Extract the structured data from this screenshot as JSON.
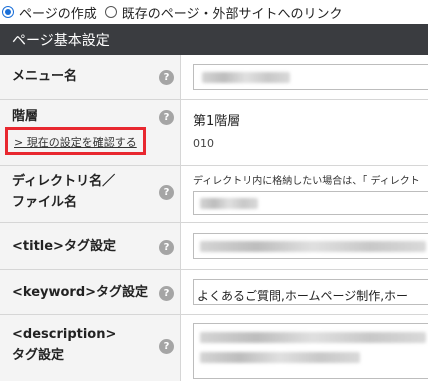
{
  "radio": {
    "options": [
      {
        "label": "ページの作成",
        "checked": true
      },
      {
        "label": "既存のページ・外部サイトへのリンク",
        "checked": false
      }
    ]
  },
  "section": {
    "title": "ページ基本設定"
  },
  "rows": {
    "menu_name": {
      "label": "メニュー名",
      "help": "?"
    },
    "level": {
      "label": "階層",
      "help": "?",
      "value": "第1階層",
      "code": "010",
      "link": "> 現在の設定を確認する"
    },
    "directory": {
      "label_line1": "ディレクトリ名／",
      "label_line2": "ファイル名",
      "help": "?",
      "hint": "ディレクトリ内に格納したい場合は、「 ディレクト"
    },
    "title_tag": {
      "label": "<title>タグ設定",
      "help": "?"
    },
    "keyword_tag": {
      "label": "<keyword>タグ設定",
      "help": "?",
      "value": "よくあるご質問,ホームページ制作,ホー"
    },
    "description_tag": {
      "label_line1": "<description>",
      "label_line2": "タグ設定",
      "help": "?"
    }
  }
}
